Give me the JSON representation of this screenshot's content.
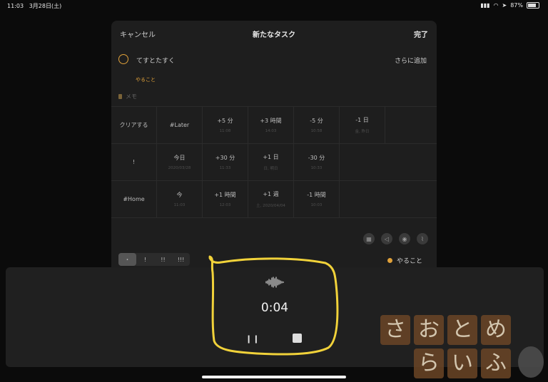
{
  "status": {
    "time": "11:03",
    "date": "3月28日(土)",
    "battery": "87%"
  },
  "nav": {
    "cancel": "キャンセル",
    "title": "新たなタスク",
    "done": "完了"
  },
  "task": {
    "title": "てすとたすく",
    "add_more": "さらに追加",
    "list_tag": "やること",
    "memo_placeholder": "メモ"
  },
  "grid": [
    [
      {
        "main": "クリアする",
        "sub": ""
      },
      {
        "main": "#Later",
        "sub": ""
      },
      {
        "main": "+5 分",
        "sub": "11:08"
      },
      {
        "main": "+3 時間",
        "sub": "14:03"
      },
      {
        "main": "-5 分",
        "sub": "10:58"
      },
      {
        "main": "-1 日",
        "sub": "金, 昨日"
      },
      {
        "main": "",
        "sub": ""
      }
    ],
    [
      {
        "main": "!",
        "sub": ""
      },
      {
        "main": "今日",
        "sub": "2020/03/28"
      },
      {
        "main": "+30 分",
        "sub": "11:33"
      },
      {
        "main": "+1 日",
        "sub": "日, 明日"
      },
      {
        "main": "-30 分",
        "sub": "10:33"
      },
      {
        "main": "",
        "sub": ""
      },
      {
        "main": "",
        "sub": ""
      }
    ],
    [
      {
        "main": "#Home",
        "sub": ""
      },
      {
        "main": "今",
        "sub": "11:03"
      },
      {
        "main": "+1 時間",
        "sub": "12:03"
      },
      {
        "main": "+1 週",
        "sub": "土, 2020/04/04"
      },
      {
        "main": "-1 時間",
        "sub": "10:03"
      },
      {
        "main": "",
        "sub": ""
      },
      {
        "main": "",
        "sub": ""
      }
    ]
  ],
  "icons": [
    "calendar-icon",
    "megaphone-icon",
    "location-icon",
    "paperclip-icon"
  ],
  "priority": [
    "・",
    "!",
    "!!",
    "!!!"
  ],
  "priority_selected": 0,
  "list_name": "やること",
  "recorder": {
    "elapsed": "0:04"
  },
  "watermark": {
    "row1": [
      "さ",
      "お",
      "と",
      "め"
    ],
    "row2": [
      "ら",
      "い",
      "ふ"
    ]
  },
  "colors": {
    "accent": "#e0a13a",
    "annotation": "#f1d23a",
    "background": "#0b0b0b",
    "panel": "#1e1e1e"
  }
}
